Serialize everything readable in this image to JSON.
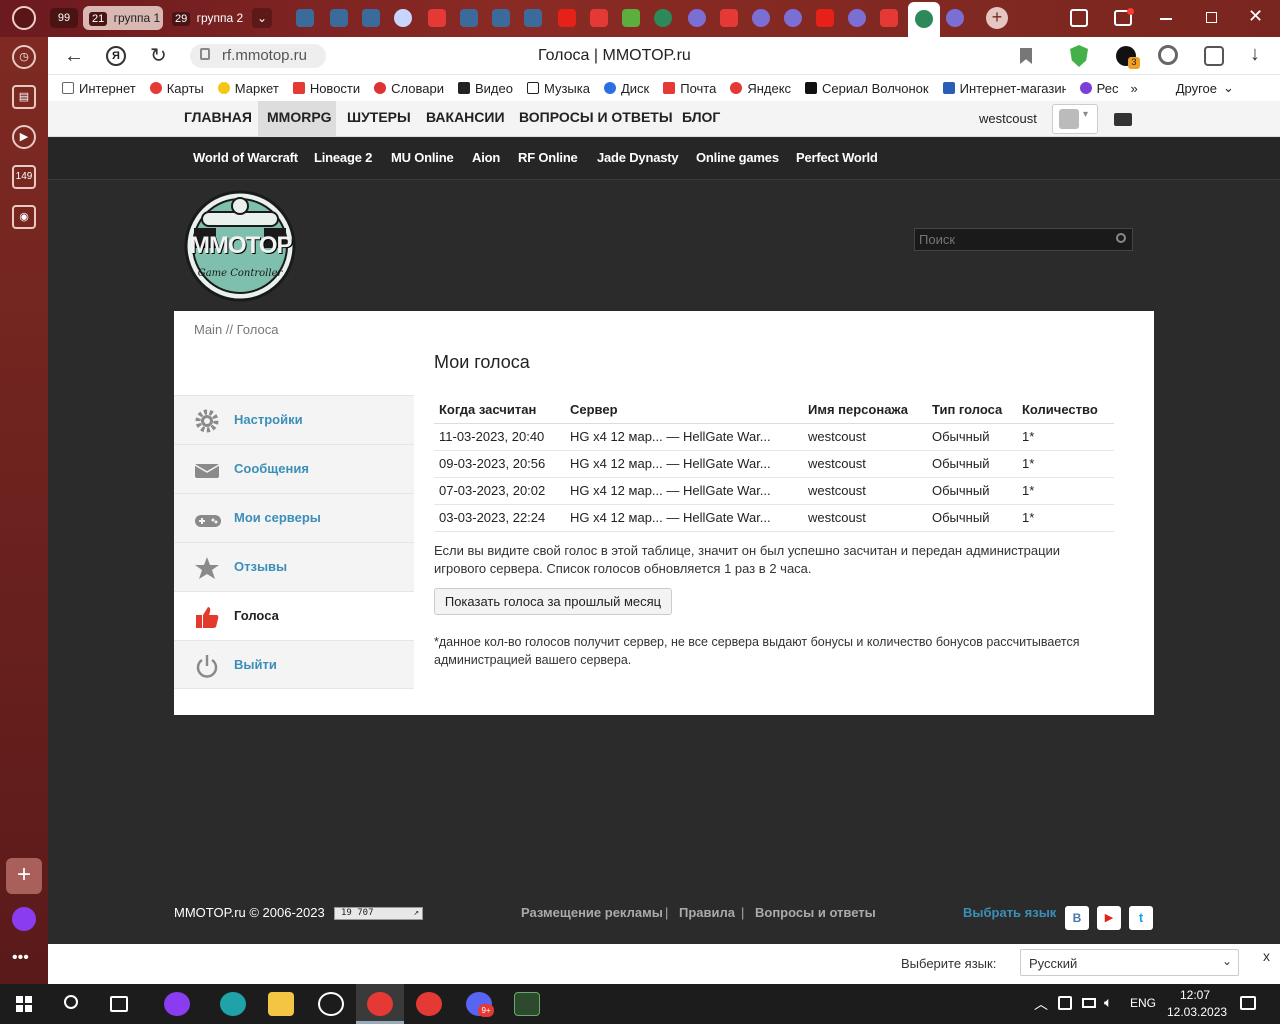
{
  "browser": {
    "tab_counters": [
      "99",
      "21",
      "29"
    ],
    "groups": [
      "группа 1",
      "группа 2"
    ],
    "address": "rf.mmotop.ru",
    "page_title": "Голоса | MMOTOP.ru",
    "side_counter": "149",
    "bookmarks": [
      "Интернет",
      "Карты",
      "Маркет",
      "Новости",
      "Словари",
      "Видео",
      "Музыка",
      "Диск",
      "Почта",
      "Яндекс",
      "Сериал Волчонок",
      "Интернет-магазин",
      "Рес"
    ],
    "bookmarks_more": "Другое",
    "accent": "#7a2620"
  },
  "site": {
    "nav": [
      "ГЛАВНАЯ",
      "MMORPG",
      "ШУТЕРЫ",
      "ВАКАНСИИ",
      "ВОПРОСЫ И ОТВЕТЫ",
      "БЛОГ"
    ],
    "username": "westcoust",
    "games": [
      "World of Warcraft",
      "Lineage 2",
      "MU Online",
      "Aion",
      "RF Online",
      "Jade Dynasty",
      "Online games",
      "Perfect World"
    ],
    "logo": "MMOTOP",
    "logo_sub": "Game Controller",
    "search_placeholder": "Поиск",
    "breadcrumb": "Main // Голоса",
    "heading": "Мои голоса",
    "sidebar": [
      {
        "label": "Настройки",
        "icon": "gear-icon"
      },
      {
        "label": "Сообщения",
        "icon": "envelope-icon"
      },
      {
        "label": "Мои серверы",
        "icon": "gamepad-icon"
      },
      {
        "label": "Отзывы",
        "icon": "star-icon"
      },
      {
        "label": "Голоса",
        "icon": "thumbs-up-icon"
      },
      {
        "label": "Выйти",
        "icon": "power-icon"
      }
    ],
    "table": {
      "headers": [
        "Когда засчитан",
        "Сервер",
        "Имя персонажа",
        "Тип голоса",
        "Количество"
      ],
      "rows": [
        [
          "11-03-2023, 20:40",
          "HG x4 12 мар... — HellGate War...",
          "westcoust",
          "Обычный",
          "1*"
        ],
        [
          "09-03-2023, 20:56",
          "HG x4 12 мар... — HellGate War...",
          "westcoust",
          "Обычный",
          "1*"
        ],
        [
          "07-03-2023, 20:02",
          "HG x4 12 мар... — HellGate War...",
          "westcoust",
          "Обычный",
          "1*"
        ],
        [
          "03-03-2023, 22:24",
          "HG x4 12 мар... — HellGate War...",
          "westcoust",
          "Обычный",
          "1*"
        ]
      ]
    },
    "info_text": "Если вы видите свой голос в этой таблице, значит он был успешно засчитан и передан администрации игрового сервера. Список голосов обновляется 1 раз в 2 часа.",
    "prev_month_button": "Показать голоса за прошлый месяц",
    "footnote": "*данное кол-во голосов получит сервер, не все сервера выдают бонусы и количество бонусов рассчитывается администрацией вашего сервера.",
    "footer": {
      "copyright": "MMOTOP.ru © 2006-2023",
      "counter": "19 707",
      "links": [
        "Размещение рекламы",
        "Правила",
        "Вопросы и ответы"
      ],
      "separator": "|",
      "choose_language": "Выбрать язык",
      "social": [
        "В",
        "▶",
        "t"
      ]
    },
    "lang_bar": {
      "label": "Выберите язык:",
      "selected": "Русский",
      "close": "x"
    }
  },
  "taskbar": {
    "lang": "ENG",
    "time": "12:07",
    "date": "12.03.2023",
    "badge": "9+"
  }
}
